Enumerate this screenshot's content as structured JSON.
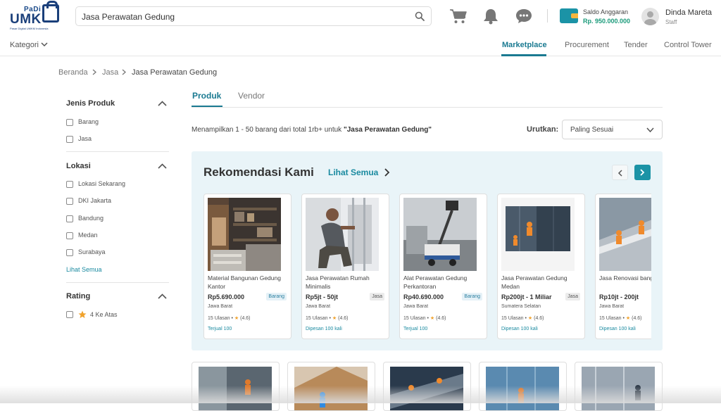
{
  "header": {
    "logo": {
      "brand": "PaDi",
      "name": "UMK",
      "tagline": "Pasar Digital UMKM Indonesia"
    },
    "search": {
      "value": "Jasa Perawatan Gedung",
      "placeholder": ""
    },
    "icons": [
      "cart-icon",
      "bell-icon",
      "chat-icon"
    ],
    "saldo": {
      "label": "Saldo Anggaran",
      "value": "Rp. 950.000.000"
    },
    "user": {
      "name": "Dinda Mareta",
      "role": "Staff"
    }
  },
  "nav": {
    "kategori": "Kategori",
    "tabs": [
      {
        "label": "Marketplace",
        "active": true
      },
      {
        "label": "Procurement",
        "active": false
      },
      {
        "label": "Tender",
        "active": false
      },
      {
        "label": "Control Tower",
        "active": false
      }
    ]
  },
  "breadcrumb": [
    "Beranda",
    "Jasa",
    "Jasa Perawatan Gedung"
  ],
  "filters": {
    "jenis_produk": {
      "title": "Jenis Produk",
      "options": [
        "Barang",
        "Jasa"
      ]
    },
    "lokasi": {
      "title": "Lokasi",
      "options": [
        "Lokasi Sekarang",
        "DKI Jakarta",
        "Bandung",
        "Medan",
        "Surabaya"
      ],
      "more": "Lihat Semua"
    },
    "rating": {
      "title": "Rating",
      "options": [
        "4 Ke Atas"
      ]
    }
  },
  "product_tabs": [
    {
      "label": "Produk",
      "active": true
    },
    {
      "label": "Vendor",
      "active": false
    }
  ],
  "results": {
    "prefix": "Menampilkan 1 - 50 barang dari total 1rb+ untuk ",
    "query": "\"Jasa Perawatan Gedung\""
  },
  "sort": {
    "label": "Urutkan:",
    "value": "Paling Sesuai"
  },
  "recommendation": {
    "title": "Rekomendasi Kami",
    "see_all": "Lihat Semua",
    "items": [
      {
        "name": "Material Bangunan Gedung Kantor",
        "price": "Rp5.690.000",
        "badge": "Barang",
        "location": "Jawa Barat",
        "reviews": "15 Ulasan •",
        "rating": "(4.6)",
        "sold": "Terjual 100"
      },
      {
        "name": "Jasa Perawatan  Rumah Minimalis",
        "price": "Rp5jt - 50jt",
        "badge": "Jasa",
        "location": "Jawa Barat",
        "reviews": "15 Ulasan •",
        "rating": "(4.6)",
        "sold": "Dipesan 100 kali"
      },
      {
        "name": "Alat Perawatan Gedung Perkantoran",
        "price": "Rp40.690.000",
        "badge": "Barang",
        "location": "Jawa Barat",
        "reviews": "15 Ulasan •",
        "rating": "(4.6)",
        "sold": "Terjual 100"
      },
      {
        "name": "Jasa Perawatan Gedung Medan",
        "price": "Rp200jt - 1 Miliar",
        "badge": "Jasa",
        "location": "Sumatera Selatan",
        "reviews": "15 Ulasan •",
        "rating": "(4.6)",
        "sold": "Dipesan 100 kali"
      },
      {
        "name": "Jasa Renovasi bangunan",
        "price": "Rp10jt - 200jt",
        "badge": "",
        "location": "Jawa Barat",
        "reviews": "15 Ulasan •",
        "rating": "(4.6)",
        "sold": "Dipesan 100 kali"
      }
    ]
  },
  "colors": {
    "accent": "#1a7a91",
    "teal": "#1b93a6",
    "panel": "#e9f4f8",
    "star": "#f0a22c",
    "saldo": "#1a9a7a"
  }
}
